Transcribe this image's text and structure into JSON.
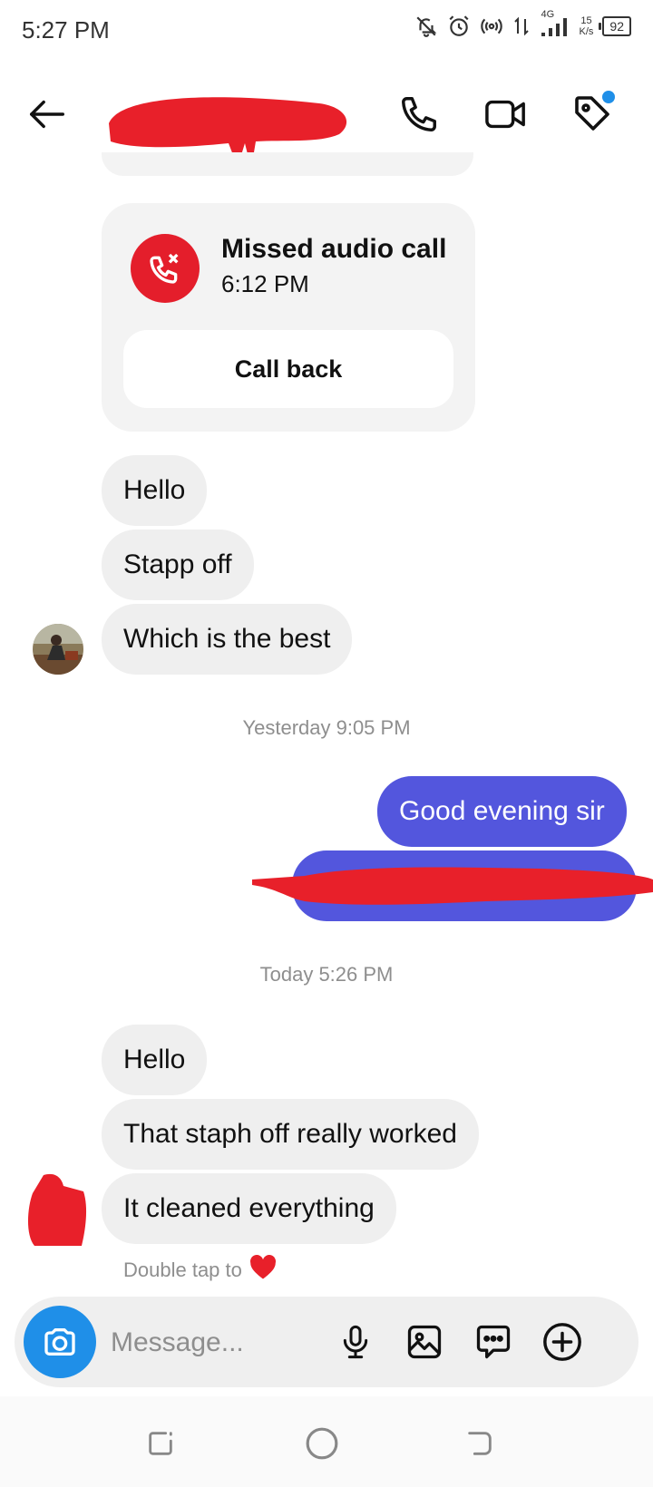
{
  "status_bar": {
    "time": "5:27 PM",
    "network": "4G",
    "speed_value": "15",
    "speed_unit": "K/s",
    "battery": "92"
  },
  "header": {
    "icons": [
      "back-arrow-icon",
      "phone-icon",
      "video-camera-icon",
      "tag-icon"
    ],
    "tag_badge_color": "#1f8fe8"
  },
  "missed_call": {
    "title": "Missed audio call",
    "time": "6:12 PM",
    "action": "Call back",
    "icon_color": "#e41e2b"
  },
  "thread": {
    "group1": [
      "Hello",
      "Stapp off",
      "Which is the best"
    ],
    "timestamp1": "Yesterday 9:05 PM",
    "sent1": "Good evening sir",
    "timestamp2": "Today 5:26 PM",
    "group2": [
      "Hello",
      "That staph off really worked",
      "It cleaned everything"
    ],
    "double_tap": "Double tap to"
  },
  "composer": {
    "placeholder": "Message...",
    "icons": [
      "camera-icon",
      "microphone-icon",
      "gallery-icon",
      "sticker-chat-icon",
      "plus-circle-icon"
    ]
  },
  "colors": {
    "sent_bubble": "#5356dd",
    "received_bubble": "#efefef",
    "camera_button": "#1f8fe8",
    "redaction": "#e8202a"
  }
}
